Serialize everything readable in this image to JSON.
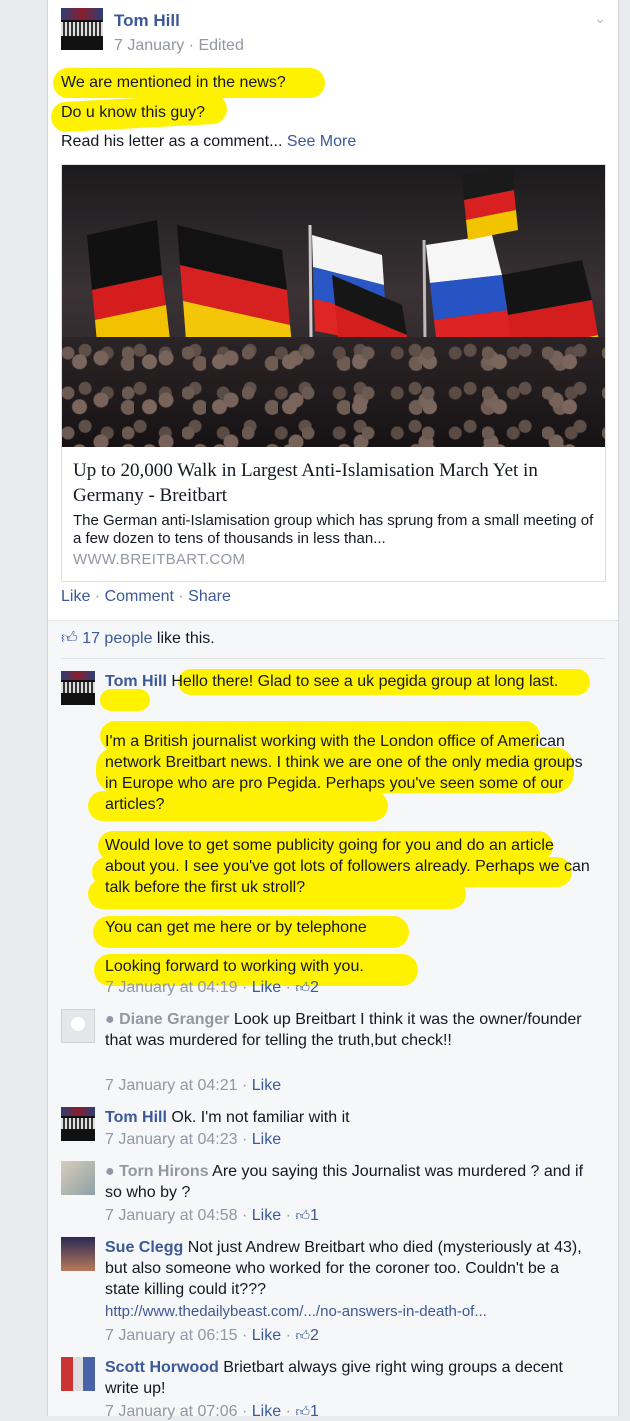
{
  "post": {
    "author": "Tom Hill",
    "meta": "7 January · Edited",
    "line1": "We are mentioned in the news?",
    "line2": "Do u know this guy?",
    "line3_prefix": "Read his letter as a comment...",
    "see_more": "See More",
    "preview": {
      "title": "Up to 20,000 Walk in Largest Anti-Islamisation March Yet in Germany - Breitbart",
      "description": "The German anti-Islamisation group which has sprung from a small meeting of a few dozen to tens of thousands in less than...",
      "source": "WWW.BREITBART.COM"
    },
    "actions": {
      "like": "Like",
      "comment": "Comment",
      "share": "Share",
      "sep": " · "
    }
  },
  "likes": {
    "count_text": "17 people",
    "suffix": " like this."
  },
  "comments": [
    {
      "author": "Tom Hill",
      "paragraphs": [
        "Hello there! Glad to see a uk pegida group at long last.",
        "I'm a British journalist working with the London office of American network Breitbart news. I think we are one of the only media groups in Europe who are pro Pegida. Perhaps you've seen some of our articles?",
        "Would love to get some publicity going for you and do an article about you. I see you've got lots of followers already. Perhaps we can talk before the first uk stroll?",
        "You can get me here or by telephone",
        "Looking forward to working with you."
      ],
      "time": "7 January at 04:19",
      "like": "Like",
      "likes": "2"
    },
    {
      "author": "Diane Granger",
      "text": "Look up Breitbart I think it was the owner/founder that was murdered for telling the truth,but check!!",
      "time": "7 January at 04:21",
      "like": "Like"
    },
    {
      "author": "Tom Hill",
      "text": "Ok. I'm not familiar with it",
      "time": "7 January at 04:23",
      "like": "Like"
    },
    {
      "author": "Torn Hirons",
      "text": "Are you saying this Journalist was murdered ? and if so who by ?",
      "time": "7 January at 04:58",
      "like": "Like",
      "likes": "1"
    },
    {
      "author": "Sue Clegg",
      "text": "Not just Andrew Breitbart who died (mysteriously at 43), but also someone who worked for the coroner too. Couldn't be a state killing could it???",
      "url": "http://www.thedailybeast.com/.../no-answers-in-death-of...",
      "time": "7 January at 06:15",
      "like": "Like",
      "likes": "2"
    },
    {
      "author": "Scott Horwood",
      "text": "Brietbart always give right wing groups a decent write up!",
      "time": "7 January at 07:06",
      "like": "Like",
      "likes": "1"
    }
  ],
  "colors": {
    "link": "#3b5998",
    "highlight": "#fff200",
    "grey": "#9197a3"
  }
}
